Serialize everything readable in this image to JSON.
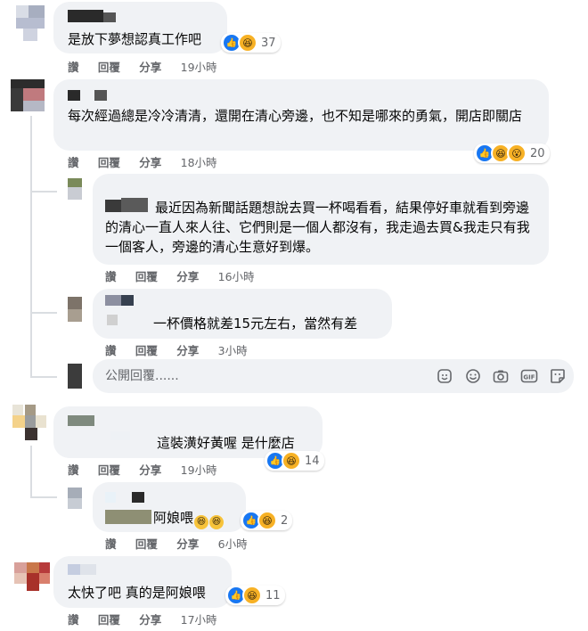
{
  "reactions": {
    "like_icon": "like-icon",
    "haha_icon": "haha-icon",
    "wow_icon": "wow-icon"
  },
  "actions": {
    "like": "讚",
    "reply": "回覆",
    "share": "分享"
  },
  "comments": [
    {
      "text": "是放下夢想認真工作吧",
      "reaction_count": "37",
      "time": "19小時"
    },
    {
      "text": "每次經過總是冷冷清清，還開在清心旁邊，也不知是哪來的勇氣，開店即關店",
      "reaction_count": "20",
      "time": "18小時"
    },
    {
      "text": "最近因為新聞話題想說去買一杯喝看看，結果停好車就看到旁邊的清心一直人來人往、它們則是一個人都沒有，我走過去買&我走只有我一個客人，旁邊的清心生意好到爆。",
      "time": "16小時"
    },
    {
      "text": "一杯價格就差15元左右，當然有差",
      "time": "3小時"
    },
    {
      "text": "這裝潢好黃喔 是什麼店",
      "reaction_count": "14",
      "time": "19小時"
    },
    {
      "text": "阿娘喂",
      "reaction_count": "2",
      "time": "6小時"
    },
    {
      "text": "太快了吧 真的是阿娘喂",
      "reaction_count": "11",
      "time": "17小時"
    }
  ],
  "reply_box": {
    "placeholder": "公開回覆......"
  },
  "composer_tools": [
    "sticker-icon",
    "emoji-icon",
    "camera-icon",
    "gif-icon",
    "sticker-face-icon"
  ],
  "colors": {
    "like_blue": "#1877f2",
    "haha_yellow": "#f7b125",
    "bubble_gray": "#f0f2f5",
    "meta_gray": "#65676b"
  }
}
